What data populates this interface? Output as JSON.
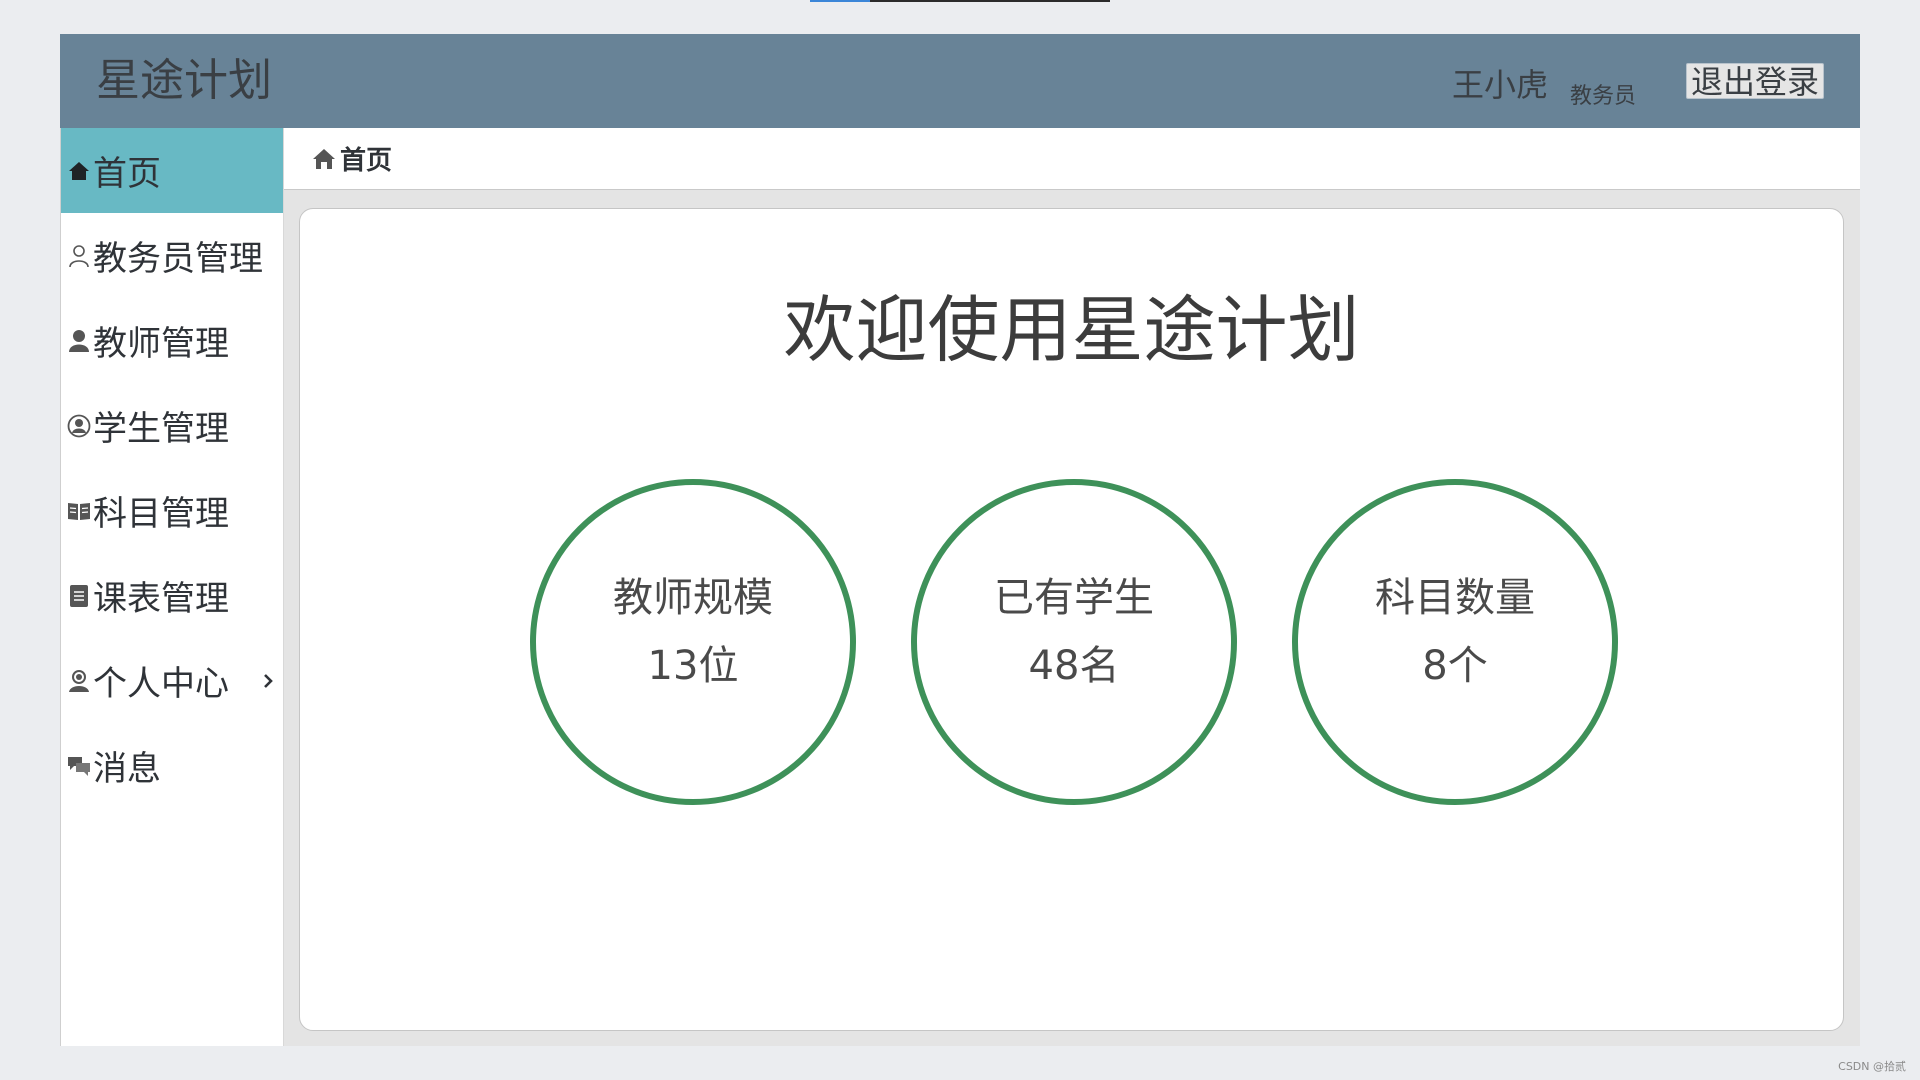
{
  "page_progress": {
    "fraction": 0.2
  },
  "header": {
    "app_title": "星途计划",
    "user_name": "王小虎",
    "user_role": "教务员",
    "logout_label": "退出登录"
  },
  "sidebar": {
    "items": [
      {
        "label": "首页",
        "icon": "home-icon",
        "active": true
      },
      {
        "label": "教务员管理",
        "icon": "user-outline-icon"
      },
      {
        "label": "教师管理",
        "icon": "user-solid-icon"
      },
      {
        "label": "学生管理",
        "icon": "user-circle-icon"
      },
      {
        "label": "科目管理",
        "icon": "book-icon"
      },
      {
        "label": "课表管理",
        "icon": "document-icon"
      },
      {
        "label": "个人中心",
        "icon": "user-profile-icon",
        "has_submenu": true
      },
      {
        "label": "消息",
        "icon": "chat-icon"
      }
    ]
  },
  "breadcrumb": {
    "label": "首页",
    "icon": "home-icon"
  },
  "main": {
    "welcome": "欢迎使用星途计划",
    "stats": [
      {
        "label": "教师规模",
        "value": "13位"
      },
      {
        "label": "已有学生",
        "value": "48名"
      },
      {
        "label": "科目数量",
        "value": "8个"
      }
    ]
  },
  "colors": {
    "header_bg": "#688397",
    "active_nav_bg": "#68b9c4",
    "stat_ring": "#3e9159"
  },
  "watermark": "CSDN @拾贰"
}
